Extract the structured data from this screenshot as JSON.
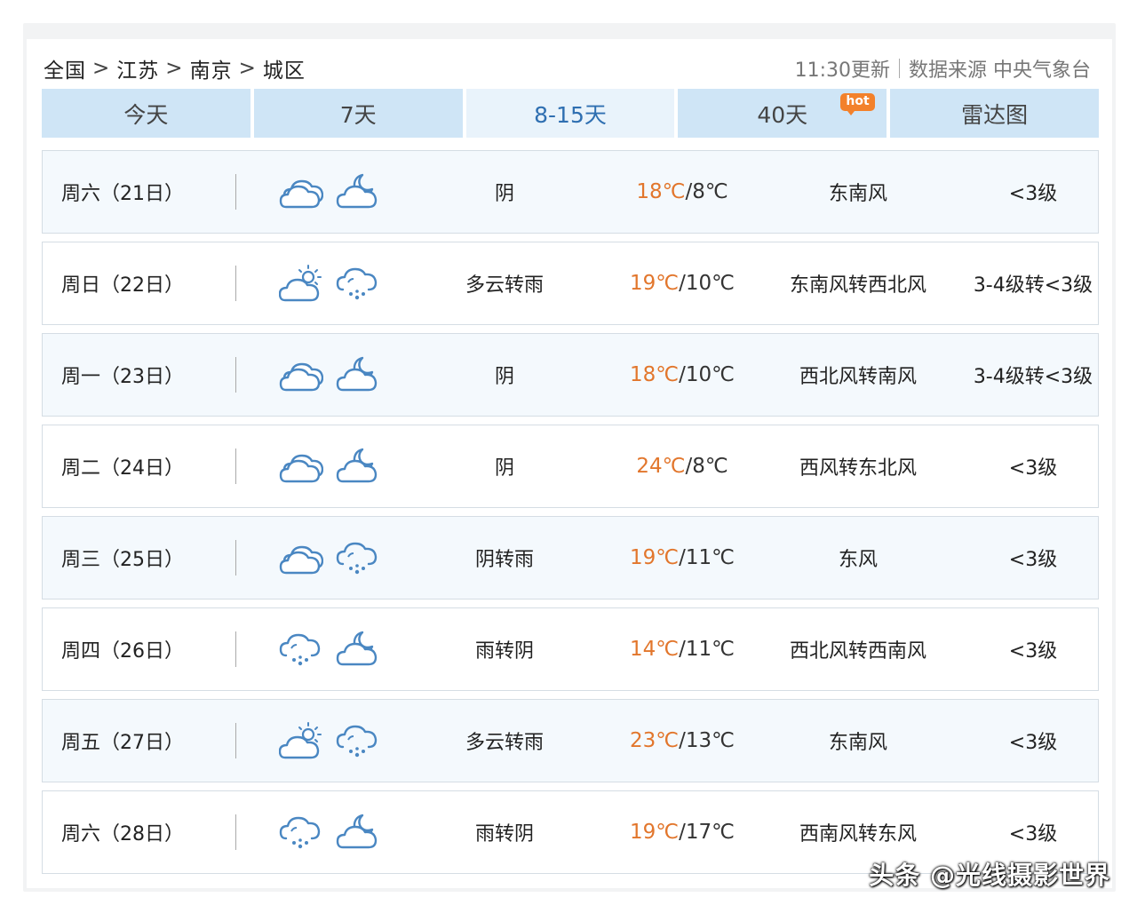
{
  "breadcrumb": [
    "全国",
    "江苏",
    "南京",
    "城区"
  ],
  "breadcrumb_separator": ">",
  "update_time": "11:30更新",
  "data_source": "数据来源 中央气象台",
  "tabs": [
    {
      "label": "今天",
      "active": false
    },
    {
      "label": "7天",
      "active": false
    },
    {
      "label": "8-15天",
      "active": true
    },
    {
      "label": "40天",
      "active": false,
      "badge": "hot"
    },
    {
      "label": "雷达图",
      "active": false
    }
  ],
  "icon_names": {
    "cloudy": "overcast-cloud-icon",
    "cloudy_night": "cloud-moon-icon",
    "partly_cloudy": "sun-cloud-icon",
    "rain": "rain-cloud-icon"
  },
  "forecast": [
    {
      "date": "周六（21日）",
      "icons": [
        "cloudy",
        "cloudy_night"
      ],
      "weather": "阴",
      "high": "18℃",
      "low": "8℃",
      "wind": "东南风",
      "level": "<3级"
    },
    {
      "date": "周日（22日）",
      "icons": [
        "partly_cloudy",
        "rain"
      ],
      "weather": "多云转雨",
      "high": "19℃",
      "low": "10℃",
      "wind": "东南风转西北风",
      "level": "3-4级转<3级"
    },
    {
      "date": "周一（23日）",
      "icons": [
        "cloudy",
        "cloudy_night"
      ],
      "weather": "阴",
      "high": "18℃",
      "low": "10℃",
      "wind": "西北风转南风",
      "level": "3-4级转<3级"
    },
    {
      "date": "周二（24日）",
      "icons": [
        "cloudy",
        "cloudy_night"
      ],
      "weather": "阴",
      "high": "24℃",
      "low": "8℃",
      "wind": "西风转东北风",
      "level": "<3级"
    },
    {
      "date": "周三（25日）",
      "icons": [
        "cloudy",
        "rain"
      ],
      "weather": "阴转雨",
      "high": "19℃",
      "low": "11℃",
      "wind": "东风",
      "level": "<3级"
    },
    {
      "date": "周四（26日）",
      "icons": [
        "rain",
        "cloudy_night"
      ],
      "weather": "雨转阴",
      "high": "14℃",
      "low": "11℃",
      "wind": "西北风转西南风",
      "level": "<3级"
    },
    {
      "date": "周五（27日）",
      "icons": [
        "partly_cloudy",
        "rain"
      ],
      "weather": "多云转雨",
      "high": "23℃",
      "low": "13℃",
      "wind": "东南风",
      "level": "<3级"
    },
    {
      "date": "周六（28日）",
      "icons": [
        "rain",
        "cloudy_night"
      ],
      "weather": "雨转阴",
      "high": "19℃",
      "low": "17℃",
      "wind": "西南风转东风",
      "level": "<3级"
    }
  ],
  "colors": {
    "tab_bg": "#cfe5f6",
    "tab_active_text": "#2f6fb1",
    "high_temp": "#e2762c",
    "icon_stroke": "#4a87c2",
    "hot_badge": "#f3812b"
  },
  "watermark": "头条 @光线摄影世界"
}
